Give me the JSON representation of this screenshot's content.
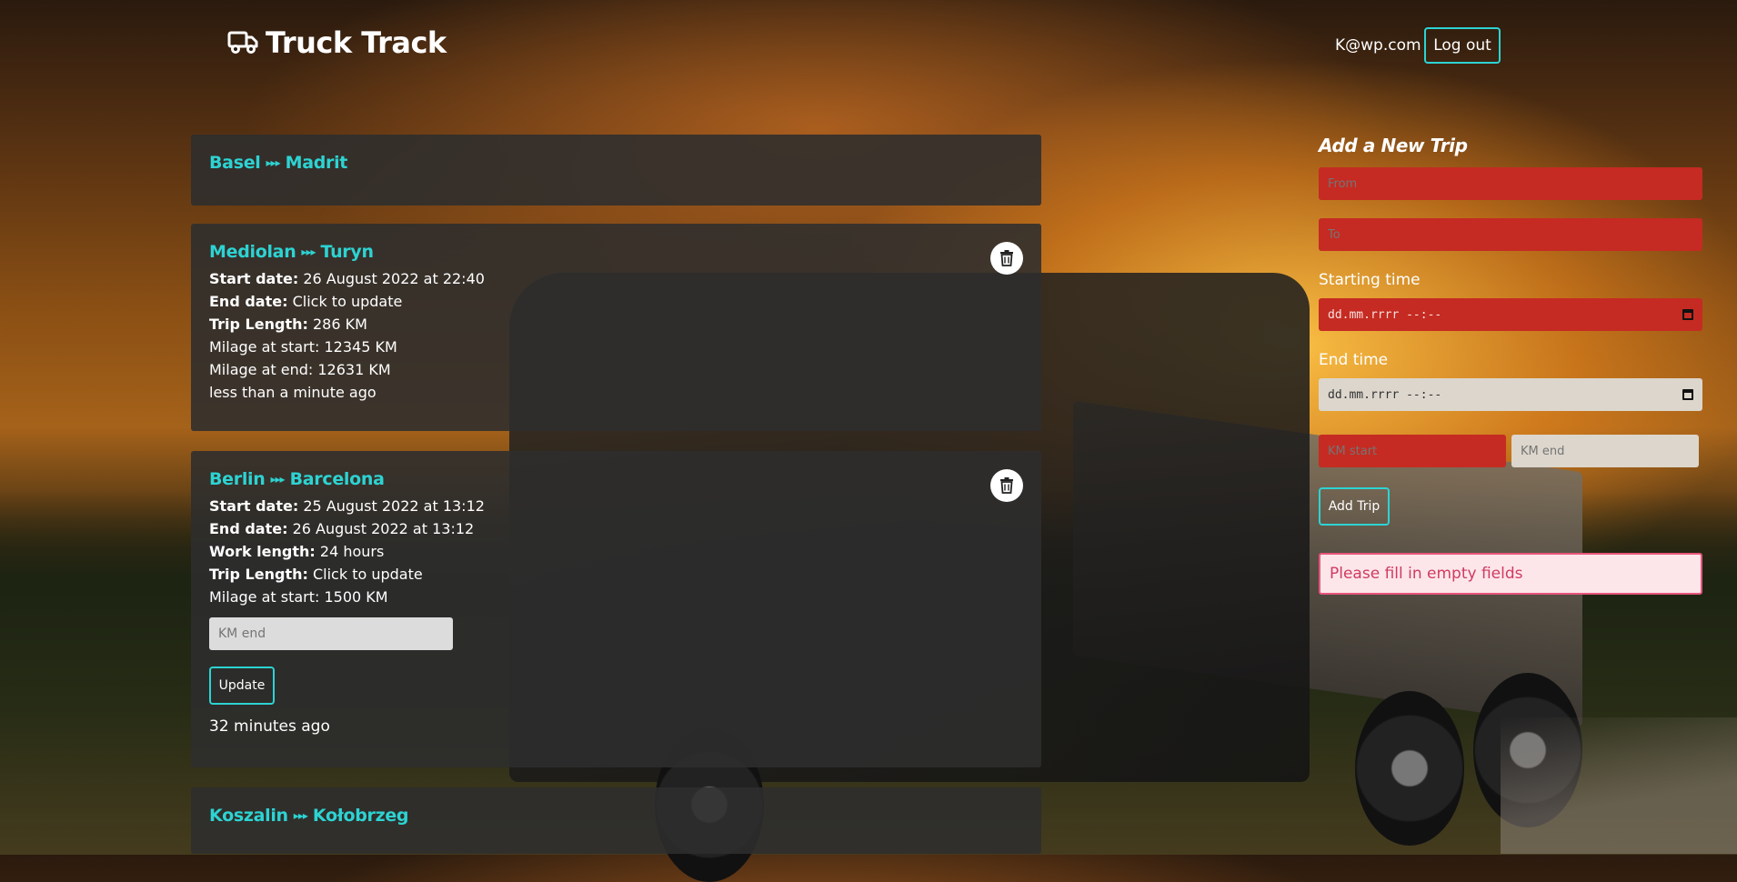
{
  "header": {
    "brand": "Truck Track",
    "user_email": "K@wp.com",
    "logout_label": "Log out"
  },
  "trips": [
    {
      "from": "Basel",
      "to": "Madrit"
    },
    {
      "from": "Mediolan",
      "to": "Turyn",
      "fields": [
        {
          "label": "Start date:",
          "value": "26 August 2022 at 22:40"
        },
        {
          "label": "End date:",
          "value": "Click to update"
        },
        {
          "label": "Trip Length:",
          "value": "286 KM"
        }
      ],
      "milage_start": "Milage at start: 12345 KM",
      "milage_end": "Milage at end: 12631 KM",
      "ago": "less than a minute ago"
    },
    {
      "from": "Berlin",
      "to": "Barcelona",
      "fields": [
        {
          "label": "Start date:",
          "value": "25 August 2022 at 13:12"
        },
        {
          "label": "End date:",
          "value": "26 August 2022 at 13:12"
        },
        {
          "label": "Work length:",
          "value": "24 hours"
        },
        {
          "label": "Trip Length:",
          "value": "Click to update"
        }
      ],
      "milage_start": "Milage at start: 1500 KM",
      "km_end_placeholder": "KM end",
      "update_label": "Update",
      "ago": "32 minutes ago"
    },
    {
      "from": "Koszalin",
      "to": "Kołobrzeg"
    }
  ],
  "route_arrow": "▸▸▸",
  "form": {
    "title": "Add a New Trip",
    "from_placeholder": "From",
    "to_placeholder": "To",
    "start_label": "Starting time",
    "start_placeholder": "dd.mm.rrrr --:--",
    "end_label": "End time",
    "end_placeholder": "dd.mm.rrrr --:--",
    "km_start_placeholder": "KM start",
    "km_end_placeholder": "KM end",
    "add_label": "Add Trip",
    "error": "Please fill in empty fields"
  },
  "colors": {
    "accent": "#2dd3d3",
    "error_field": "#c52b22",
    "card_bg": "#2d2d2d",
    "error_msg_bg": "#fde6ea",
    "error_msg_text": "#d13a60"
  },
  "icons": {
    "brand": "truck-icon",
    "delete": "trash-icon",
    "calendar": "calendar-icon"
  }
}
